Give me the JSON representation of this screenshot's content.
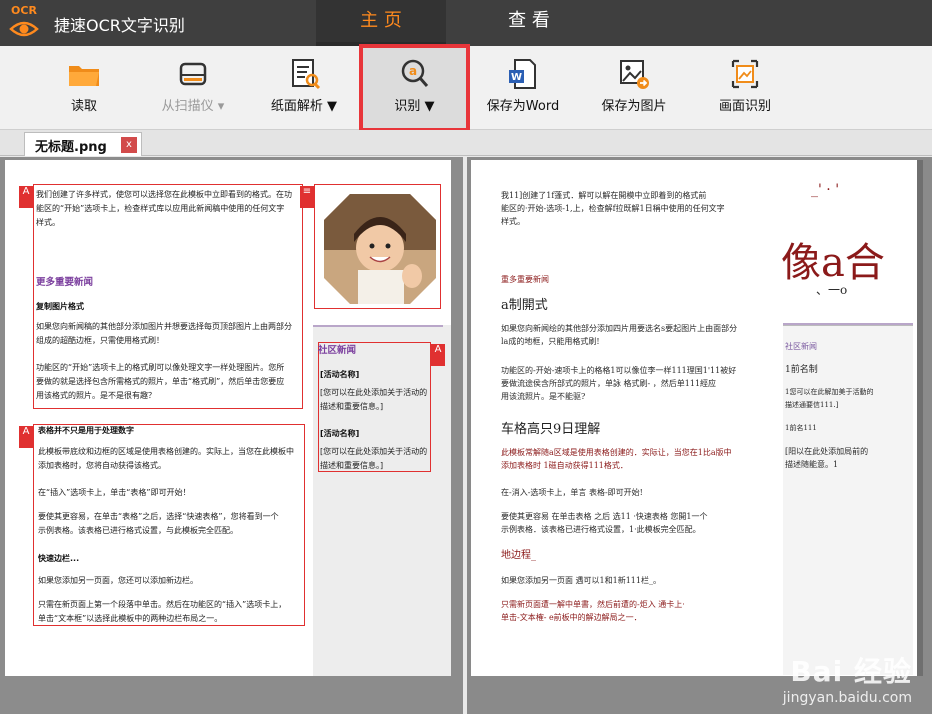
{
  "app": {
    "logo_text": "OCR",
    "title": "捷速OCR文字识别"
  },
  "nav": {
    "tabs": [
      {
        "label": "主 页",
        "active": true
      },
      {
        "label": "查 看",
        "active": false
      }
    ]
  },
  "toolbar": {
    "tools": [
      {
        "label": "读取",
        "icon": "folder-icon",
        "disabled": false
      },
      {
        "label": "从扫描仪 ▾",
        "icon": "scanner-icon",
        "disabled": true
      },
      {
        "label": "纸面解析 ▼",
        "icon": "page-analysis-icon",
        "disabled": false
      },
      {
        "label": "识别 ▼",
        "icon": "recognize-icon",
        "disabled": false,
        "selected": true
      },
      {
        "label": "保存为Word",
        "icon": "word-icon",
        "disabled": false
      },
      {
        "label": "保存为图片",
        "icon": "save-image-icon",
        "disabled": false
      },
      {
        "label": "画面识别",
        "icon": "screen-recognize-icon",
        "disabled": false
      }
    ]
  },
  "document_tab": {
    "name": "无标题.png",
    "close": "x"
  },
  "left_page": {
    "region_tag": "A",
    "intro": [
      "我们创建了许多样式，使您可以选择您在此模板中立即看到的格式。在功",
      "能区的“开始”选项卡上，检查样式库以应用此新闻稿中使用的任何文字",
      "样式。"
    ],
    "heading_news": "更多重要新闻",
    "copy_title": "复制图片格式",
    "copy_text": [
      "如果您向新闻稿的其他部分添加图片并想要选择每页顶部图片上由两部分",
      "组成的超酷边框，只需使用格式刷！"
    ],
    "brush_text": [
      "功能区的“开始”选项卡上的格式刷可以像处理文字一样处理图片。您所",
      "要做的就是选择包含所需格式的照片，单击“格式刷”，然后单击您要应",
      "用该格式的照片。是不是很有趣？"
    ],
    "table_title": "表格并不只是用于处理数字",
    "table_text": [
      "此模板带底纹和边框的区域是使用表格创建的。实际上，当您在此模板中",
      "添加表格时，您将自动获得该格式。"
    ],
    "insert_text": "在“插入”选项卡上，单击“表格”即可开始！",
    "quick_text": [
      "要使其更容易，在单击“表格”之后，选择“快速表格”，您将看到一个",
      "示例表格。该表格已进行格式设置，与此模板完全匹配。"
    ],
    "quick_border": "快速边栏...",
    "sidebar_text": "如果您添加另一页面，您还可以添加新边栏。",
    "last_text": [
      "只需在新页面上第一个段落中单击。然后在功能区的“插入”选项卡上，",
      "单击“文本框”以选择此模板中的两种边栏布局之一。"
    ],
    "side_title": "社区新闻",
    "event1": "[活动名称]",
    "event1_desc": [
      "[您可以在此处添加关于活动的",
      "描述和重要信息。]"
    ],
    "event2": "[活动名称]",
    "event2_desc": [
      "[您可以在此处添加关于活动的",
      "描述和重要信息。]"
    ]
  },
  "right_page": {
    "intro": [
      "我11]创建了1f蓬式．解可以解在開模中立即着到的格式前",
      "能区的·开始-选项-1,上，检查解f拉既解1日稱中使用的任何文字",
      "样式。"
    ],
    "news": "重多重要新闻",
    "copy_head": "a制開式",
    "copy_text": [
      "如果您向新闻绘的其他部分添加四片用要选名s要起图片上由面部分",
      "la成的地框，只能用格式刷!"
    ],
    "brush_text": [
      "功能区的-开始-速项卡上的格格1可以像位李一样111理国1'11被好",
      "要做流途侯含所部式的照片，单詠 格式刷-  ，然后单111經应",
      "用该流照片。是不能驱?"
    ],
    "table_head": "车格高只9日理解",
    "table_text": [
      "此模板常解随a区域是使用表格创建的．实际让，当您在1比a版中",
      "添加表格时  1磁自动获得111格式．"
    ],
    "insert_text": "在-消入-选项卡上，单言 表格-即可开始!",
    "quick_text": [
      "要使其更容易 在单击表格 之后 选11 ·快速表格    您開1一个",
      "示例表格．该表格已进行格式设置，1·此模板完全匹配。"
    ],
    "border_head": "地边程_",
    "sidebar_text": "如果您添加另一页面  遇可以1和1新111栏_。",
    "last_text": [
      "只需新页面遭一解中单書，然后前遭的-炬入  通卡上·",
      "单击-文本榷-  e前板中的解边解局之一．"
    ],
    "big_title": "像a合",
    "title_marks": "_' ·    '",
    "title_sub": "、一o",
    "side_title": "社区新闻",
    "event1": "1前名制",
    "event1_desc": [
      "1您可以在此解加美于活動的",
      "描述通要信111.]"
    ],
    "event2": "1前名111",
    "event2_desc": [
      "[阳以在此处添加局前的",
      "描述随能意。1"
    ]
  },
  "watermark": {
    "line1": "Bai 经验",
    "line2": "jingyan.baidu.com"
  }
}
